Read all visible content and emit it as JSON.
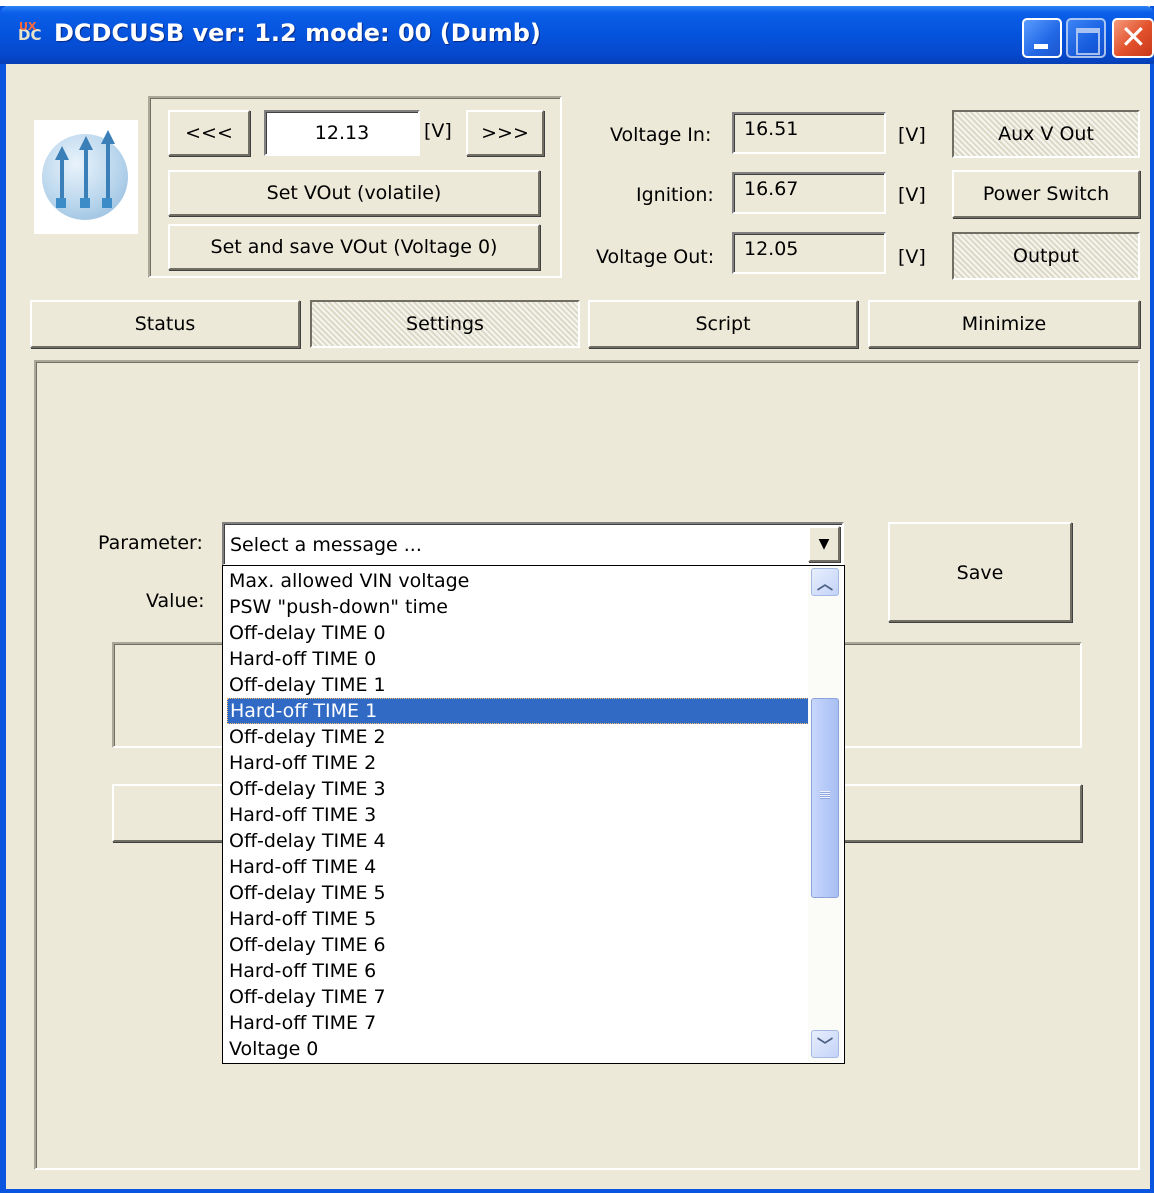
{
  "window": {
    "title": "DCDCUSB ver: 1.2 mode: 00 (Dumb)",
    "icon": "app-dc-icon",
    "icon_text": "DC",
    "icon_badge": "UX",
    "controls": [
      "minimize",
      "maximize",
      "close"
    ],
    "close_glyph": "✕"
  },
  "vout": {
    "dec_label": "<<<",
    "value": "12.13",
    "unit": "[V]",
    "inc_label": ">>>",
    "set_volatile_label": "Set VOut (volatile)",
    "set_save_label": "Set and save VOut (Voltage 0)"
  },
  "readings": {
    "voltage_in_label": "Voltage In:",
    "voltage_in_value": "16.51",
    "ignition_label": "Ignition:",
    "ignition_value": "16.67",
    "voltage_out_label": "Voltage Out:",
    "voltage_out_value": "12.05",
    "unit": "[V]"
  },
  "indicators": {
    "aux_label": "Aux V Out",
    "power_switch_label": "Power Switch",
    "output_label": "Output"
  },
  "tabs": [
    {
      "label": "Status",
      "active": false
    },
    {
      "label": "Settings",
      "active": true
    },
    {
      "label": "Script",
      "active": false
    },
    {
      "label": "Minimize",
      "active": false
    }
  ],
  "settings": {
    "parameter_label": "Parameter:",
    "value_label": "Value:",
    "combo_text": "Select a message ...",
    "save_label": "Save",
    "selected_index": 5,
    "options": [
      "Max. allowed VIN voltage",
      "PSW \"push-down\" time",
      "Off-delay TIME 0",
      "Hard-off TIME 0",
      "Off-delay TIME 1",
      "Hard-off TIME 1",
      "Off-delay TIME 2",
      "Hard-off TIME 2",
      "Off-delay TIME 3",
      "Hard-off TIME 3",
      "Off-delay TIME 4",
      "Hard-off TIME 4",
      "Off-delay TIME 5",
      "Hard-off TIME 5",
      "Off-delay TIME 6",
      "Hard-off TIME 6",
      "Off-delay TIME 7",
      "Hard-off TIME 7",
      "Voltage 0"
    ],
    "scroll_up_glyph": "︿",
    "scroll_down_glyph": "﹀",
    "combo_arrow_glyph": "▼"
  },
  "colors": {
    "titlebar": "#0553dc",
    "window_bg": "#ece9d8",
    "selection": "#316ac5"
  }
}
